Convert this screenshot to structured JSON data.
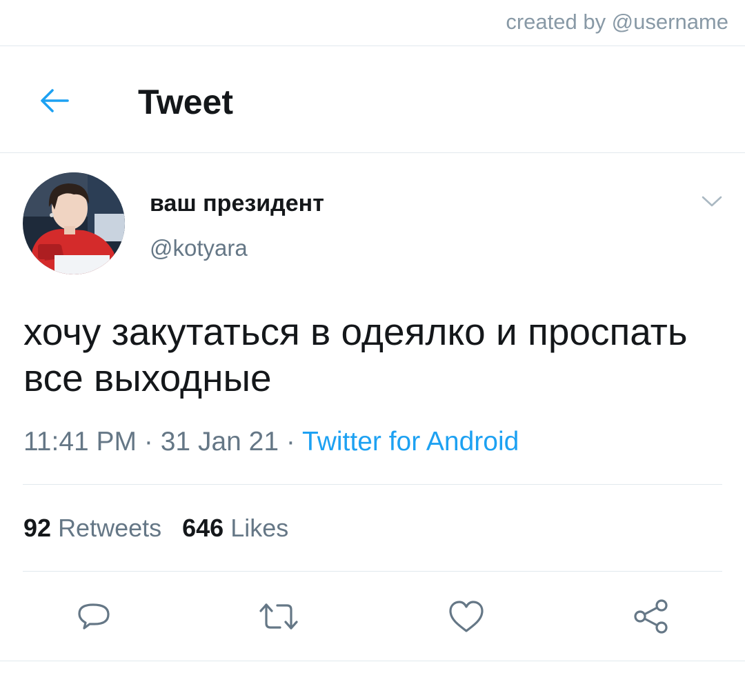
{
  "watermark": {
    "text": "created by @username"
  },
  "header": {
    "title": "Tweet",
    "back_icon": "arrow-left-icon"
  },
  "tweet": {
    "author": {
      "display_name": "ваш президент",
      "handle": "@kotyara",
      "avatar": "profile-photo"
    },
    "more_icon": "chevron-down-icon",
    "text": "хочу закутаться в одеялко и проспать все выходные",
    "time": "11:41 PM",
    "date": "31 Jan 21",
    "separator": "·",
    "source": "Twitter for Android",
    "retweets": {
      "count": "92",
      "label": "Retweets"
    },
    "likes": {
      "count": "646",
      "label": "Likes"
    }
  },
  "actions": [
    {
      "name": "reply",
      "icon": "reply-icon"
    },
    {
      "name": "retweet",
      "icon": "retweet-icon"
    },
    {
      "name": "like",
      "icon": "heart-icon"
    },
    {
      "name": "share",
      "icon": "share-icon"
    }
  ],
  "colors": {
    "accent": "#1da1f2",
    "text_primary": "#14171a",
    "text_secondary": "#657786",
    "divider": "#e1e8ed",
    "watermark": "#8899a6",
    "icon": "#657786"
  }
}
